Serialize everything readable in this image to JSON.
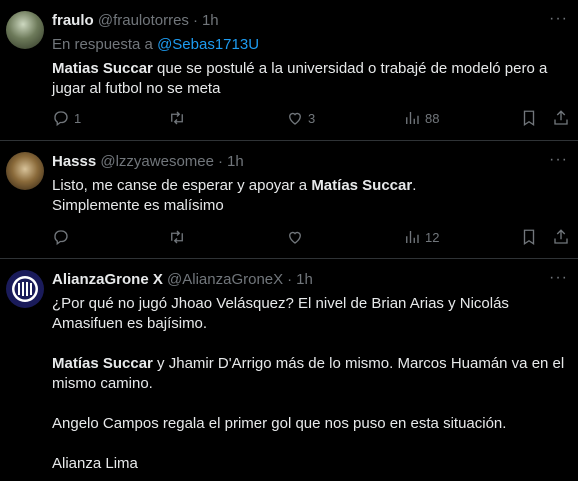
{
  "tweets": [
    {
      "name": "fraulo",
      "handle": "@fraulotorres",
      "time": "1h",
      "reply_prefix": "En respuesta a",
      "reply_mention": "@Sebas1713U",
      "text_bold": "Matias Succar",
      "text_rest": " que se postulé a la universidad o trabajé de modeló pero a jugar al futbol no se meta",
      "replies": "1",
      "reposts": "",
      "likes": "3",
      "views": "88",
      "icons": [
        "reply-icon",
        "repost-icon",
        "like-icon",
        "views-icon",
        "bookmark-icon",
        "share-icon"
      ]
    },
    {
      "name": "Hasss",
      "handle": "@lzzyawesomee",
      "time": "1h",
      "line1_pre": "Listo, me canse de esperar y apoyar a ",
      "line1_bold": "Matías Succar",
      "line1_post": ".",
      "line2": "Simplemente es malísimo",
      "replies": "",
      "reposts": "",
      "likes": "",
      "views": "12"
    },
    {
      "name": "AlianzaGrone X",
      "handle": "@AlianzaGroneX",
      "time": "1h",
      "p1": "¿Por qué no jugó Jhoao Velásquez? El nivel de Brian Arias y Nicolás Amasifuen es bajísimo.",
      "p2_bold": "Matías Succar",
      "p2_rest": " y Jhamir D'Arrigo más de lo mismo. Marcos Huamán va en el mismo camino.",
      "p3": "Angelo Campos regala el primer gol que nos puso en esta situación.",
      "p4": "Alianza Lima"
    }
  ],
  "separator": "·",
  "more_label": "···",
  "colors": {
    "background": "#000000",
    "text": "#e7e9ea",
    "muted": "#71767b",
    "link": "#1d9bf0",
    "border": "#2f3336"
  }
}
